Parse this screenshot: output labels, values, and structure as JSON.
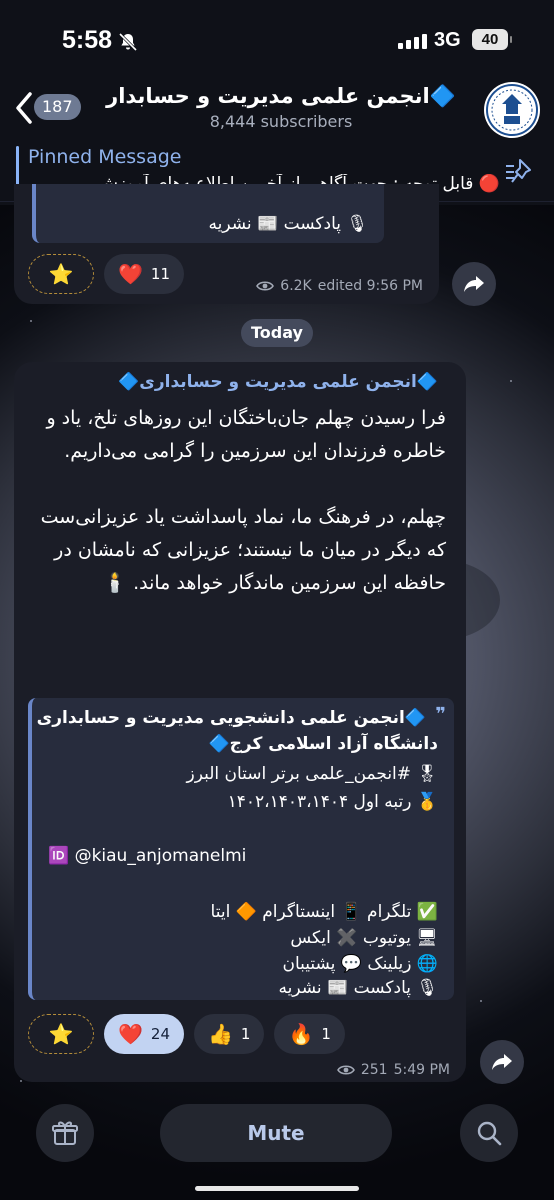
{
  "status": {
    "time": "5:58",
    "network": "3G",
    "battery": "40"
  },
  "header": {
    "back_count": "187",
    "title": "🔷انجمن علمی مدیریت و حسابدار",
    "subscribers": "8,444 subscribers"
  },
  "pinned": {
    "label": "Pinned Message",
    "text": "🔴 قابل توجه : جهت آگاهی از آخرین اطلاعیه‌های آموزش"
  },
  "message1": {
    "quote_line": "🎙 پادکست   📰 نشریه",
    "reactions": [
      {
        "emoji": "⭐",
        "count": ""
      },
      {
        "emoji": "❤️",
        "count": "11"
      }
    ],
    "views": "6.2K",
    "meta": "edited 9:56 PM"
  },
  "date_separator": "Today",
  "message2": {
    "sender": "🔷انجمن علمی مدیریت و حسابداری🔷",
    "paragraph1": "فرا رسیدن چهلم جان‌باختگان این روزهای تلخ، یاد و خاطره فرزندان این سرزمین را گرامی می‌داریم.",
    "paragraph2": "چهلم، در فرهنگ ما، نماد پاسداشت یاد عزیزانی‌ست که دیگر در میان ما نیستند؛ عزیزانی که نامشان در حافظه این سرزمین ماندگار خواهد ماند. 🕯️",
    "quote": {
      "line1": "🔷انجمن علمی دانشجویی مدیریت و حسابداری",
      "line2": "دانشگاه آزاد اسلامی کرج🔷",
      "line3": "🎖 #انجمن_علمی برتر استان البرز",
      "line4": "🥇 رتبه اول ۱۴۰۲،۱۴۰۳،۱۴۰۴",
      "line5": "🆔 @kiau_anjomanelmi",
      "line6": "✅ تلگرام  📱 اینستاگرام  🔶 ایتا",
      "line7": "🖥 یوتیوب    ✖️ ایکس",
      "line8": "🌐 زیلینک      💬 پشتیبان",
      "line9": "🎙 پادکست   📰 نشریه"
    },
    "reactions": [
      {
        "emoji": "⭐",
        "count": ""
      },
      {
        "emoji": "❤️",
        "count": "24"
      },
      {
        "emoji": "👍",
        "count": "1"
      },
      {
        "emoji": "🔥",
        "count": "1"
      }
    ],
    "views": "251",
    "time": "5:49 PM"
  },
  "bottom": {
    "mute_label": "Mute"
  }
}
